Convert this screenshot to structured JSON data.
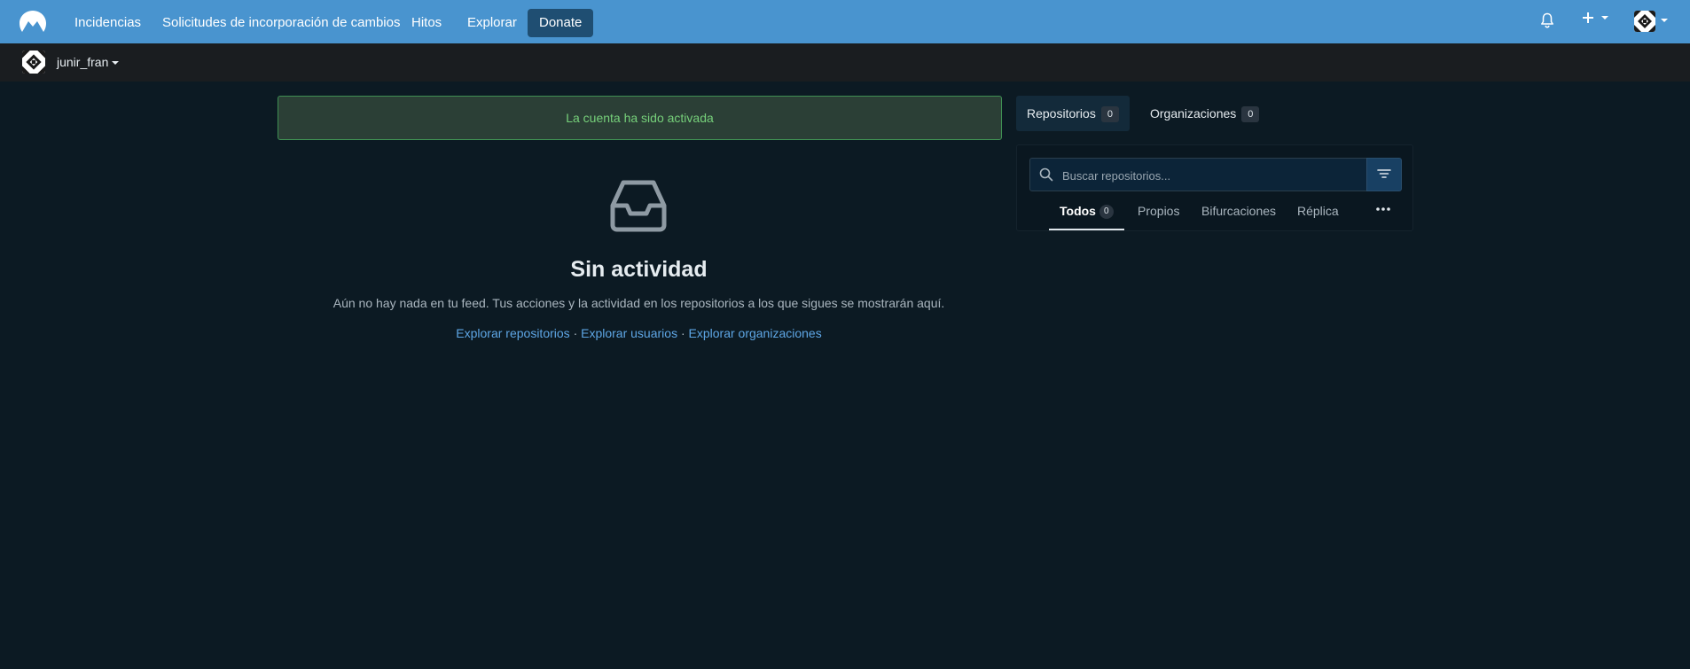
{
  "nav": {
    "items": [
      "Incidencias",
      "Solicitudes de incorporación de cambios",
      "Hitos",
      "Explorar"
    ],
    "donate": "Donate"
  },
  "user": {
    "name": "junir_fran"
  },
  "alert": {
    "text": "La cuenta ha sido activada"
  },
  "feed": {
    "title": "Sin actividad",
    "description": "Aún no hay nada en tu feed. Tus acciones y la actividad en los repositorios a los que sigues se mostrarán aquí.",
    "links": [
      "Explorar repositorios",
      "Explorar usuarios",
      "Explorar organizaciones"
    ],
    "separator": "·"
  },
  "sidebar": {
    "tabs": [
      {
        "label": "Repositorios",
        "count": "0"
      },
      {
        "label": "Organizaciones",
        "count": "0"
      }
    ],
    "search_placeholder": "Buscar repositorios...",
    "filters": [
      {
        "label": "Todos",
        "count": "0"
      },
      {
        "label": "Propios"
      },
      {
        "label": "Bifurcaciones"
      },
      {
        "label": "Réplica"
      }
    ]
  },
  "colors": {
    "topbar": "#4994cf",
    "background": "#0c1a23",
    "alert_text": "#76d07a",
    "link": "#5ea6e5"
  },
  "icons": [
    "app-logo-icon",
    "bell-icon",
    "plus-icon",
    "avatar",
    "inbox-icon",
    "search-icon",
    "filter-icon",
    "more-icon"
  ]
}
